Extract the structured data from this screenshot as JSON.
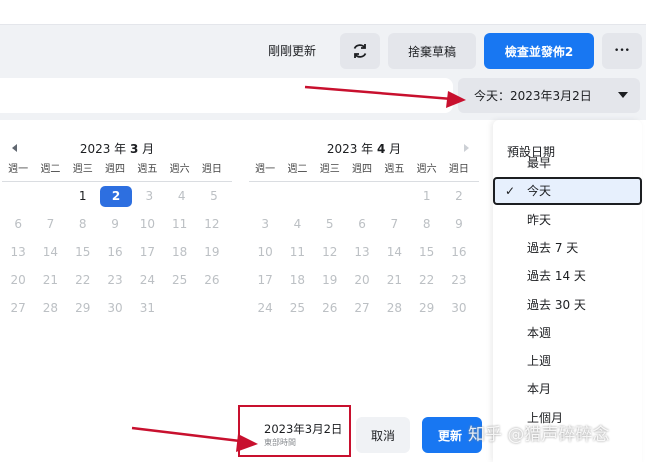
{
  "header": {
    "status": "剛剛更新",
    "refresh_icon": "refresh-icon",
    "discard_label": "捨棄草稿",
    "publish_label": "檢查並發佈2",
    "more_label": "•••"
  },
  "date_selector": {
    "label": "今天：2023年3月2日"
  },
  "calendars": [
    {
      "year": "2023",
      "year_suffix": " 年 ",
      "month": "3",
      "month_suffix": " 月",
      "weeks": [
        [
          "",
          "",
          "1",
          "2",
          "3",
          "4",
          "5"
        ],
        [
          "6",
          "7",
          "8",
          "9",
          "10",
          "11",
          "12"
        ],
        [
          "13",
          "14",
          "15",
          "16",
          "17",
          "18",
          "19"
        ],
        [
          "20",
          "21",
          "22",
          "23",
          "24",
          "25",
          "26"
        ],
        [
          "27",
          "28",
          "29",
          "30",
          "31",
          "",
          ""
        ]
      ]
    },
    {
      "year": "2023",
      "year_suffix": " 年 ",
      "month": "4",
      "month_suffix": " 月",
      "weeks": [
        [
          "",
          "",
          "",
          "",
          "",
          "1",
          "2"
        ],
        [
          "3",
          "4",
          "5",
          "6",
          "7",
          "8",
          "9"
        ],
        [
          "10",
          "11",
          "12",
          "13",
          "14",
          "15",
          "16"
        ],
        [
          "17",
          "18",
          "19",
          "20",
          "21",
          "22",
          "23"
        ],
        [
          "24",
          "25",
          "26",
          "27",
          "28",
          "29",
          "30"
        ]
      ]
    }
  ],
  "weekdays": [
    "週一",
    "週二",
    "週三",
    "週四",
    "週五",
    "週六",
    "週日"
  ],
  "selected_day": "2",
  "presets": {
    "heading": "預設日期",
    "items": [
      "最早",
      "今天",
      "昨天",
      "過去 7 天",
      "過去 14 天",
      "過去 30 天",
      "本週",
      "上週",
      "本月",
      "上個月"
    ],
    "selected_index": 1
  },
  "footer": {
    "date": "2023年3月2日",
    "timezone": "東部時間",
    "cancel_label": "取消",
    "update_label": "更新"
  },
  "watermark": "知乎 @猎声碎碎念",
  "colors": {
    "primary": "#1877f2",
    "selected": "#2d6fe0",
    "annotation": "#c8102e"
  }
}
